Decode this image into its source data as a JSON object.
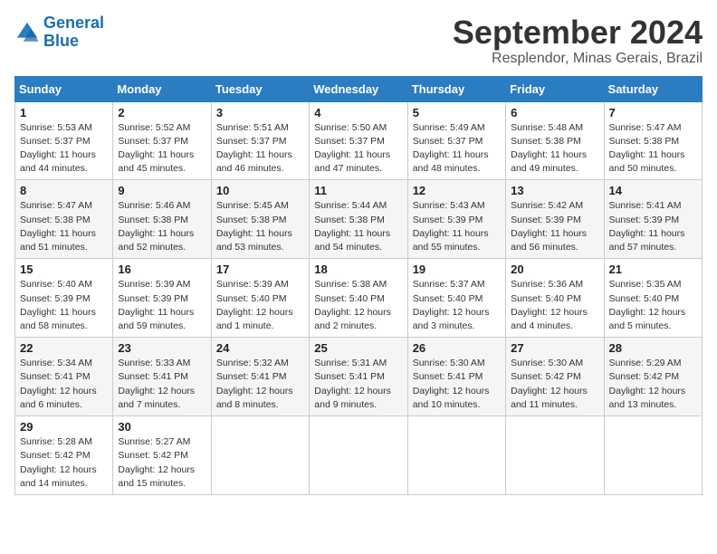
{
  "header": {
    "logo_line1": "General",
    "logo_line2": "Blue",
    "month": "September 2024",
    "location": "Resplendor, Minas Gerais, Brazil"
  },
  "weekdays": [
    "Sunday",
    "Monday",
    "Tuesday",
    "Wednesday",
    "Thursday",
    "Friday",
    "Saturday"
  ],
  "weeks": [
    [
      {
        "day": "1",
        "sunrise": "5:53 AM",
        "sunset": "5:37 PM",
        "daylight": "11 hours and 44 minutes."
      },
      {
        "day": "2",
        "sunrise": "5:52 AM",
        "sunset": "5:37 PM",
        "daylight": "11 hours and 45 minutes."
      },
      {
        "day": "3",
        "sunrise": "5:51 AM",
        "sunset": "5:37 PM",
        "daylight": "11 hours and 46 minutes."
      },
      {
        "day": "4",
        "sunrise": "5:50 AM",
        "sunset": "5:37 PM",
        "daylight": "11 hours and 47 minutes."
      },
      {
        "day": "5",
        "sunrise": "5:49 AM",
        "sunset": "5:37 PM",
        "daylight": "11 hours and 48 minutes."
      },
      {
        "day": "6",
        "sunrise": "5:48 AM",
        "sunset": "5:38 PM",
        "daylight": "11 hours and 49 minutes."
      },
      {
        "day": "7",
        "sunrise": "5:47 AM",
        "sunset": "5:38 PM",
        "daylight": "11 hours and 50 minutes."
      }
    ],
    [
      {
        "day": "8",
        "sunrise": "5:47 AM",
        "sunset": "5:38 PM",
        "daylight": "11 hours and 51 minutes."
      },
      {
        "day": "9",
        "sunrise": "5:46 AM",
        "sunset": "5:38 PM",
        "daylight": "11 hours and 52 minutes."
      },
      {
        "day": "10",
        "sunrise": "5:45 AM",
        "sunset": "5:38 PM",
        "daylight": "11 hours and 53 minutes."
      },
      {
        "day": "11",
        "sunrise": "5:44 AM",
        "sunset": "5:38 PM",
        "daylight": "11 hours and 54 minutes."
      },
      {
        "day": "12",
        "sunrise": "5:43 AM",
        "sunset": "5:39 PM",
        "daylight": "11 hours and 55 minutes."
      },
      {
        "day": "13",
        "sunrise": "5:42 AM",
        "sunset": "5:39 PM",
        "daylight": "11 hours and 56 minutes."
      },
      {
        "day": "14",
        "sunrise": "5:41 AM",
        "sunset": "5:39 PM",
        "daylight": "11 hours and 57 minutes."
      }
    ],
    [
      {
        "day": "15",
        "sunrise": "5:40 AM",
        "sunset": "5:39 PM",
        "daylight": "11 hours and 58 minutes."
      },
      {
        "day": "16",
        "sunrise": "5:39 AM",
        "sunset": "5:39 PM",
        "daylight": "11 hours and 59 minutes."
      },
      {
        "day": "17",
        "sunrise": "5:39 AM",
        "sunset": "5:40 PM",
        "daylight": "12 hours and 1 minute."
      },
      {
        "day": "18",
        "sunrise": "5:38 AM",
        "sunset": "5:40 PM",
        "daylight": "12 hours and 2 minutes."
      },
      {
        "day": "19",
        "sunrise": "5:37 AM",
        "sunset": "5:40 PM",
        "daylight": "12 hours and 3 minutes."
      },
      {
        "day": "20",
        "sunrise": "5:36 AM",
        "sunset": "5:40 PM",
        "daylight": "12 hours and 4 minutes."
      },
      {
        "day": "21",
        "sunrise": "5:35 AM",
        "sunset": "5:40 PM",
        "daylight": "12 hours and 5 minutes."
      }
    ],
    [
      {
        "day": "22",
        "sunrise": "5:34 AM",
        "sunset": "5:41 PM",
        "daylight": "12 hours and 6 minutes."
      },
      {
        "day": "23",
        "sunrise": "5:33 AM",
        "sunset": "5:41 PM",
        "daylight": "12 hours and 7 minutes."
      },
      {
        "day": "24",
        "sunrise": "5:32 AM",
        "sunset": "5:41 PM",
        "daylight": "12 hours and 8 minutes."
      },
      {
        "day": "25",
        "sunrise": "5:31 AM",
        "sunset": "5:41 PM",
        "daylight": "12 hours and 9 minutes."
      },
      {
        "day": "26",
        "sunrise": "5:30 AM",
        "sunset": "5:41 PM",
        "daylight": "12 hours and 10 minutes."
      },
      {
        "day": "27",
        "sunrise": "5:30 AM",
        "sunset": "5:42 PM",
        "daylight": "12 hours and 11 minutes."
      },
      {
        "day": "28",
        "sunrise": "5:29 AM",
        "sunset": "5:42 PM",
        "daylight": "12 hours and 13 minutes."
      }
    ],
    [
      {
        "day": "29",
        "sunrise": "5:28 AM",
        "sunset": "5:42 PM",
        "daylight": "12 hours and 14 minutes."
      },
      {
        "day": "30",
        "sunrise": "5:27 AM",
        "sunset": "5:42 PM",
        "daylight": "12 hours and 15 minutes."
      },
      null,
      null,
      null,
      null,
      null
    ]
  ]
}
